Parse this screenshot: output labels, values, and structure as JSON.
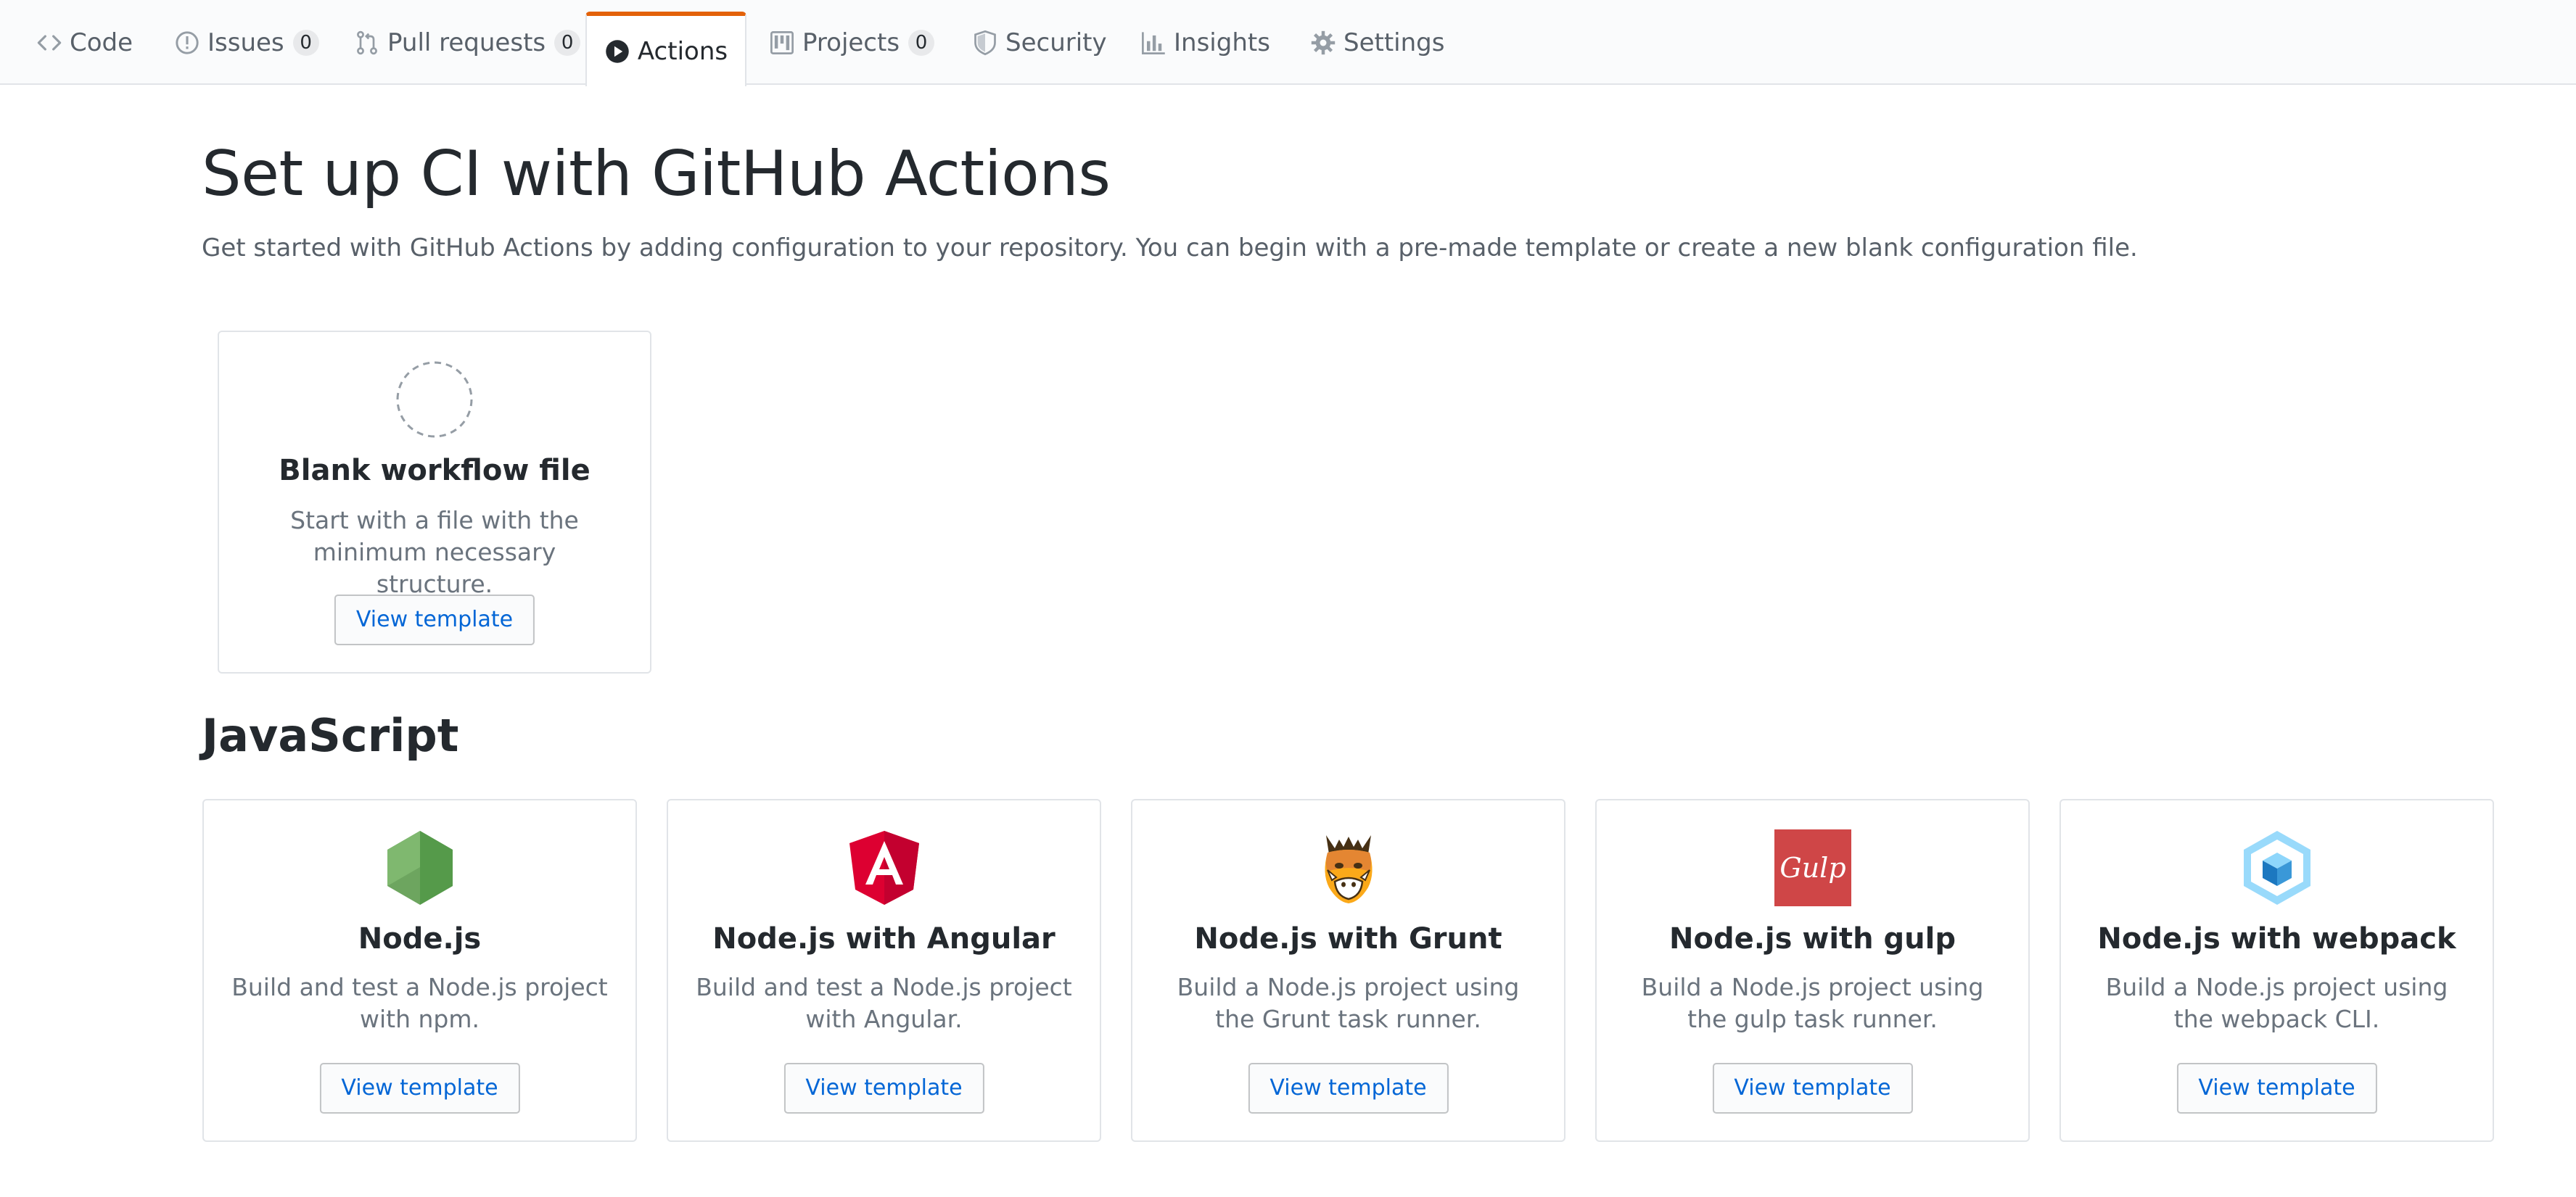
{
  "tabs": [
    {
      "label": "Code",
      "icon": "code-icon"
    },
    {
      "label": "Issues",
      "icon": "issue-icon",
      "count": "0"
    },
    {
      "label": "Pull requests",
      "icon": "pull-request-icon",
      "count": "0"
    },
    {
      "label": "Actions",
      "icon": "play-icon",
      "selected": true
    },
    {
      "label": "Projects",
      "icon": "project-icon",
      "count": "0"
    },
    {
      "label": "Security",
      "icon": "shield-icon"
    },
    {
      "label": "Insights",
      "icon": "graph-icon"
    },
    {
      "label": "Settings",
      "icon": "gear-icon"
    }
  ],
  "header": {
    "title": "Set up CI with GitHub Actions",
    "description": "Get started with GitHub Actions by adding configuration to your repository. You can begin with a pre-made template or create a new blank configuration file."
  },
  "blank": {
    "title": "Blank workflow file",
    "description": "Start with a file with the minimum necessary structure.",
    "button": "View template",
    "icon": "dashed-circle-icon"
  },
  "javascript": {
    "title": "JavaScript",
    "templates": [
      {
        "title": "Node.js",
        "description": "Build and test a Node.js project with npm.",
        "button": "View template",
        "icon": "nodejs-logo-icon"
      },
      {
        "title": "Node.js with Angular",
        "description": "Build and test a Node.js project with Angular.",
        "button": "View template",
        "icon": "angular-logo-icon"
      },
      {
        "title": "Node.js with Grunt",
        "description": "Build a Node.js project using the Grunt task runner.",
        "button": "View template",
        "icon": "grunt-logo-icon"
      },
      {
        "title": "Node.js with gulp",
        "description": "Build a Node.js project using the gulp task runner.",
        "button": "View template",
        "icon": "gulp-logo-icon"
      },
      {
        "title": "Node.js with webpack",
        "description": "Build a Node.js project using the webpack CLI.",
        "button": "View template",
        "icon": "webpack-logo-icon"
      }
    ]
  },
  "colors": {
    "accent_tab": "#e36209",
    "link": "#0366d6",
    "text": "#24292e",
    "muted": "#586069",
    "nodejs": "#6da55f",
    "angular": "#dd0031",
    "gulp": "#cf4647",
    "webpack": "#8ed6fb"
  }
}
